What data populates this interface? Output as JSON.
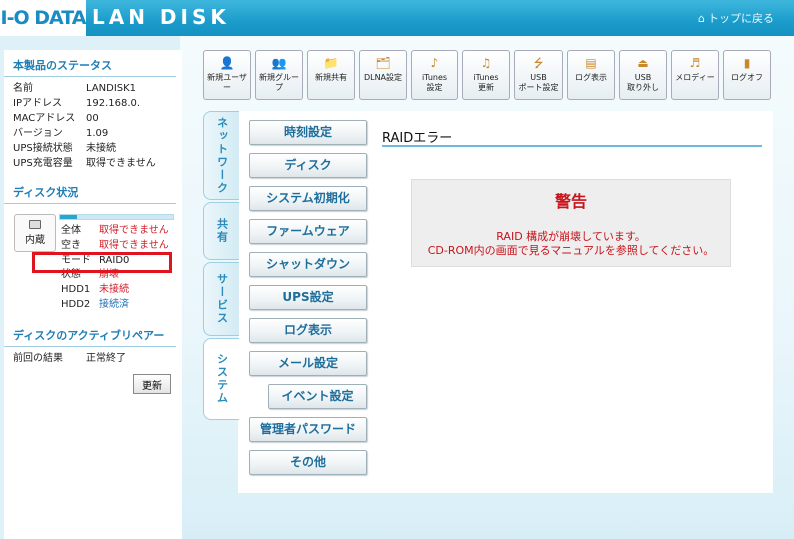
{
  "header": {
    "logo": "I-O DATA",
    "product": "LAN DISK",
    "top_link": "トップに戻る"
  },
  "status": {
    "title": "本製品のステータス",
    "rows": [
      {
        "label": "名前",
        "value": "LANDISK1"
      },
      {
        "label": "IPアドレス",
        "value": "192.168.0."
      },
      {
        "label": "MACアドレス",
        "value": "00"
      },
      {
        "label": "バージョン",
        "value": "1.09"
      },
      {
        "label": "UPS接続状態",
        "value": "未接続"
      },
      {
        "label": "UPS充電容量",
        "value": "取得できません"
      }
    ]
  },
  "disk": {
    "title": "ディスク状況",
    "icon_label": "内蔵",
    "usage_fraction": 0.15,
    "rows": [
      {
        "label": "全体",
        "value": "取得できません",
        "tone": "red"
      },
      {
        "label": "空き",
        "value": "取得できません",
        "tone": "red"
      },
      {
        "label": "モード",
        "value": "RAID0",
        "tone": "normal"
      },
      {
        "label": "状態",
        "value": "崩壊",
        "tone": "red"
      },
      {
        "label": "HDD1",
        "value": "未接続",
        "tone": "red"
      },
      {
        "label": "HDD2",
        "value": "接続済",
        "tone": "blue"
      }
    ]
  },
  "active_repair": {
    "title": "ディスクのアクティブリペアー",
    "label": "前回の結果",
    "value": "正常終了",
    "refresh_label": "更新"
  },
  "toolbar": [
    {
      "name": "new-user",
      "label1": "新規ユーザー",
      "label2": "",
      "icon": "user-icon"
    },
    {
      "name": "new-group",
      "label1": "新規グループ",
      "label2": "",
      "icon": "group-icon"
    },
    {
      "name": "new-share",
      "label1": "新規共有",
      "label2": "",
      "icon": "folder-icon"
    },
    {
      "name": "dlna",
      "label1": "DLNA設定",
      "label2": "",
      "icon": "dlna-icon"
    },
    {
      "name": "itunes-settings",
      "label1": "iTunes",
      "label2": "設定",
      "icon": "music-note-icon"
    },
    {
      "name": "itunes-update",
      "label1": "iTunes",
      "label2": "更新",
      "icon": "music-refresh-icon"
    },
    {
      "name": "usb-port",
      "label1": "USB",
      "label2": "ポート設定",
      "icon": "usb-icon"
    },
    {
      "name": "log-view",
      "label1": "ログ表示",
      "label2": "",
      "icon": "document-icon"
    },
    {
      "name": "usb-remove",
      "label1": "USB",
      "label2": "取り外し",
      "icon": "usb-eject-icon"
    },
    {
      "name": "melody",
      "label1": "メロディー",
      "label2": "",
      "icon": "melody-icon"
    },
    {
      "name": "logoff",
      "label1": "ログオフ",
      "label2": "",
      "icon": "door-icon"
    }
  ],
  "tabs": [
    {
      "name": "network",
      "label": "ネットワーク"
    },
    {
      "name": "share",
      "label": "共有"
    },
    {
      "name": "service",
      "label": "サービス"
    },
    {
      "name": "system",
      "label": "システム"
    }
  ],
  "menu": [
    "時刻設定",
    "ディスク",
    "システム初期化",
    "ファームウェア",
    "シャットダウン",
    "UPS設定",
    "ログ表示",
    "メール設定",
    "イベント設定",
    "管理者パスワード",
    "その他"
  ],
  "content": {
    "title": "RAIDエラー",
    "warning_title": "警告",
    "warning_msg1": "RAID 構成が崩壊しています。",
    "warning_msg2": "CD-ROM内の画面で見るマニュアルを参照してください。"
  },
  "colors": {
    "accent": "#1a9ccb",
    "warning": "#c8141c",
    "highlight": "#e0141e"
  }
}
